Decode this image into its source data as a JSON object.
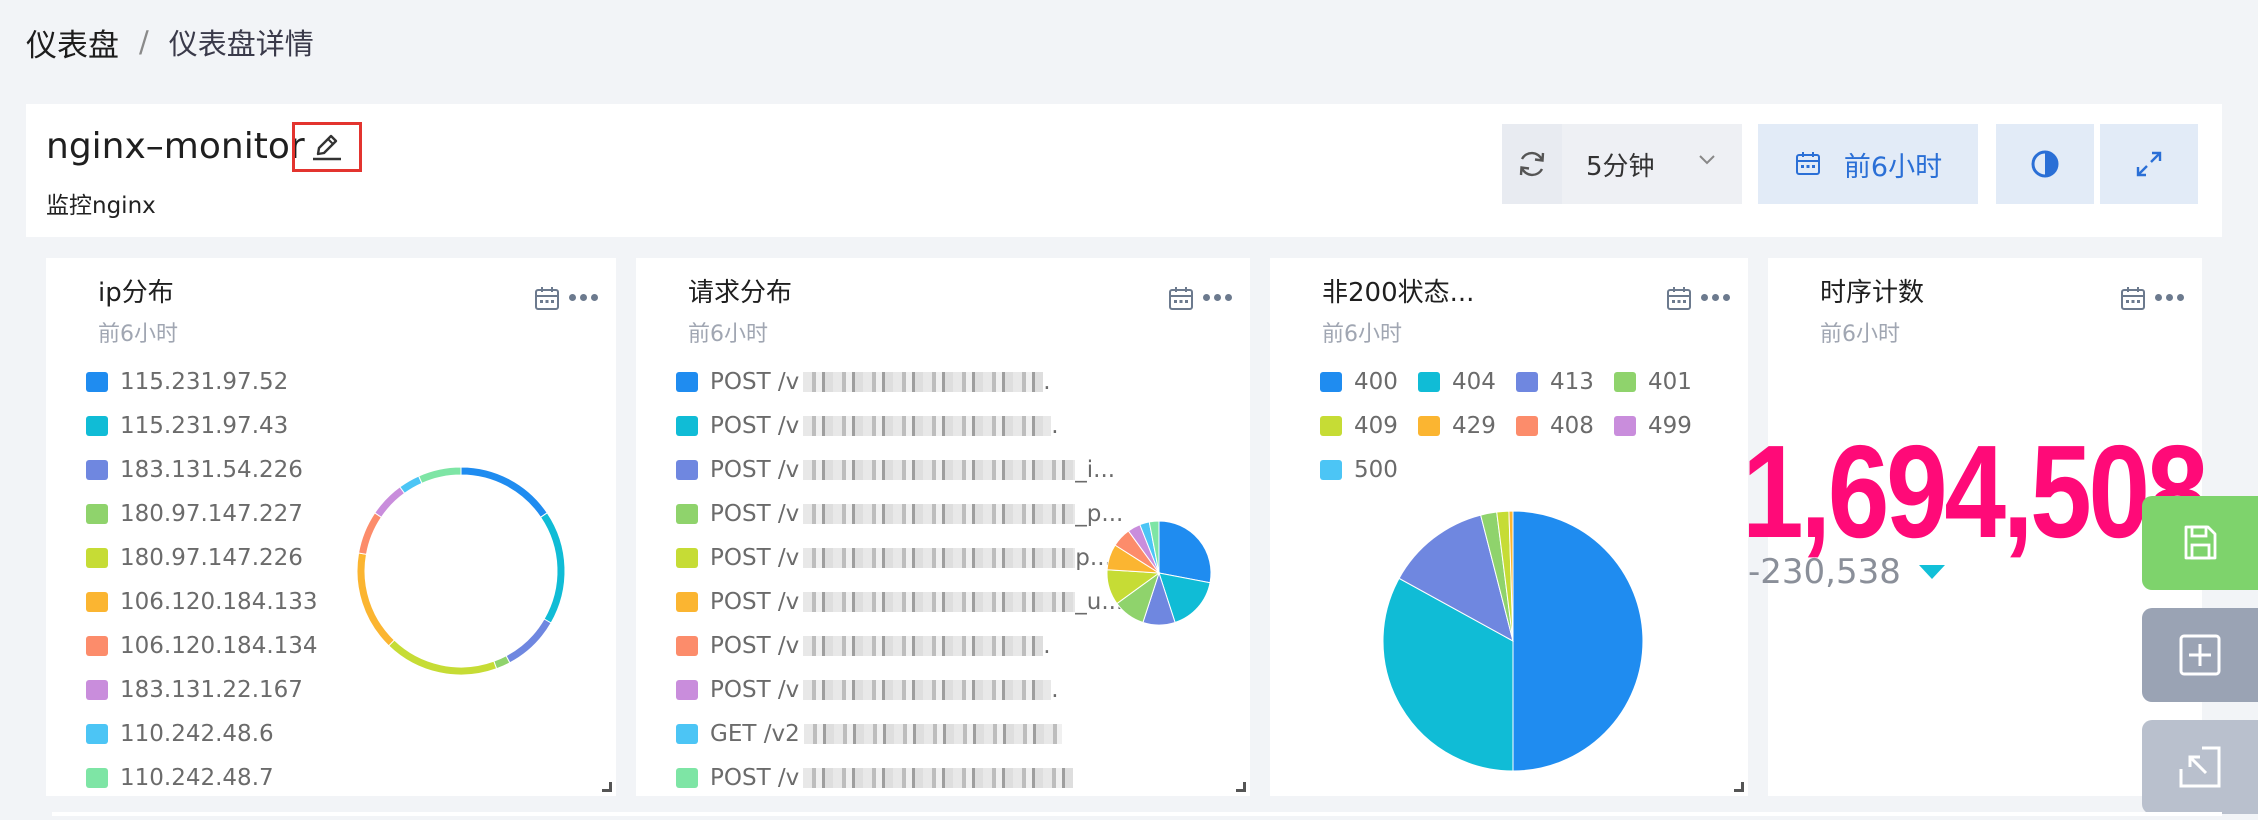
{
  "breadcrumb": {
    "root": "仪表盘",
    "separator": "/",
    "current": "仪表盘详情"
  },
  "dashboard": {
    "title": "nginx–monitor",
    "description": "监控nginx"
  },
  "controls": {
    "interval": "5分钟",
    "time_range": "前6小时"
  },
  "colors": {
    "palette": [
      "#1f8cf0",
      "#10bcd6",
      "#6f87e0",
      "#8fd36c",
      "#c6dc35",
      "#fbb531",
      "#fc8c6b",
      "#c98ddc",
      "#4cc5f5",
      "#7ee5a5"
    ],
    "big_number": "#ff0a78",
    "delta_arrow": "#12c0d8"
  },
  "cards": {
    "ip": {
      "title": "ip分布",
      "subtitle": "前6小时",
      "legend": [
        "115.231.97.52",
        "115.231.97.43",
        "183.131.54.226",
        "180.97.147.227",
        "180.97.147.226",
        "106.120.184.133",
        "106.120.184.134",
        "183.131.22.167",
        "110.242.48.6",
        "110.242.48.7"
      ]
    },
    "request": {
      "title": "请求分布",
      "subtitle": "前6小时",
      "legend": [
        "POST /v",
        "POST /v",
        "POST /v",
        "POST /v",
        "POST /v",
        "POST /v",
        "POST /v",
        "POST /v",
        "GET /v2",
        "POST /v"
      ],
      "legend_suffix": [
        ".",
        ".",
        "_i...",
        "_p...",
        "p...",
        "_u...",
        ".",
        ".",
        "",
        ""
      ]
    },
    "status": {
      "title": "非200状态...",
      "subtitle": "前6小时",
      "legend": [
        "400",
        "404",
        "413",
        "401",
        "409",
        "429",
        "408",
        "499",
        "500"
      ]
    },
    "count": {
      "title": "时序计数",
      "subtitle": "前6小时",
      "value": "1,694,508",
      "delta": "-230,538"
    }
  },
  "chart_data": [
    {
      "type": "pie",
      "variant": "donut",
      "categories": [
        "115.231.97.52",
        "115.231.97.43",
        "183.131.54.226",
        "180.97.147.227",
        "180.97.147.226",
        "106.120.184.133",
        "106.120.184.134",
        "183.131.22.167",
        "110.242.48.6",
        "110.242.48.7"
      ],
      "values": [
        14,
        16,
        8,
        2,
        16,
        14,
        6,
        5,
        3,
        6
      ]
    },
    {
      "type": "pie",
      "values": [
        28,
        17,
        10,
        10,
        11,
        8,
        6,
        4,
        3,
        3
      ]
    },
    {
      "type": "pie",
      "categories": [
        "400",
        "404",
        "413",
        "401",
        "409",
        "429",
        "408",
        "499",
        "500"
      ],
      "values": [
        50,
        33,
        13,
        2,
        1.5,
        0.5,
        0,
        0,
        0
      ]
    }
  ]
}
